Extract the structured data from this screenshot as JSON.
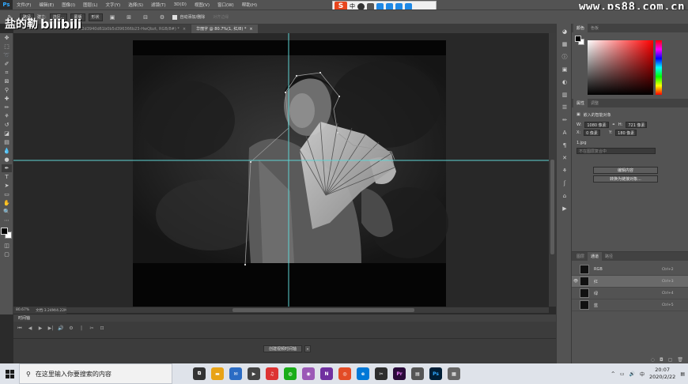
{
  "app": {
    "logo_text": "Ps"
  },
  "menu": [
    "文件(F)",
    "编辑(E)",
    "图像(I)",
    "图层(L)",
    "文字(Y)",
    "选择(S)",
    "滤镜(T)",
    "3D(D)",
    "视图(V)",
    "窗口(W)",
    "帮助(H)"
  ],
  "watermark_site": "www.ps88.com.cn",
  "watermark_logo": {
    "cn": "盐的勒",
    "en": "bilibili"
  },
  "ime": {
    "brand": "S",
    "label": "中"
  },
  "options_bar": {
    "mode": "路径",
    "make_label": "建立:",
    "make_value": "选区...",
    "mask_label": "蒙版",
    "shape_label": "形状",
    "auto_add_label": "自动添加/删除",
    "align_label": "对齐边缘"
  },
  "tabs": [
    {
      "label": "942d3940d61b0b5d396366b23-HwQbzt, RGB/8#) *",
      "active": false
    },
    {
      "label": "华丽字 @ 80.7%(1, 红/8) *",
      "active": true
    }
  ],
  "status": {
    "zoom": "80.67%",
    "doc": "文档:3.24M/4.22M"
  },
  "timeline": {
    "title": "时间轴",
    "create_button": "创建视频时间轴",
    "controls": [
      "⏮",
      "◀",
      "▶",
      "▶|",
      "🔊",
      "⚙",
      "|",
      "✂",
      "⊡"
    ]
  },
  "color_panel": {
    "tabs": [
      "颜色",
      "色板"
    ]
  },
  "properties": {
    "tabs": [
      "属性",
      "调整"
    ],
    "title": "嵌入的智能对象",
    "w_label": "W:",
    "w_value": "1080 像素",
    "h_label": "H:",
    "h_value": "721 像素",
    "x_label": "X:",
    "x_value": "0 像素",
    "y_label": "Y:",
    "y_value": "180 像素",
    "file": "1.jpg",
    "comp_placeholder": "不在图层复合中",
    "edit_button": "编辑内容",
    "convert_button": "转换为链接对象..."
  },
  "channels_panel": {
    "tabs": [
      "图层",
      "通道",
      "路径"
    ],
    "rows": [
      {
        "name": "RGB",
        "shortcut": "Ctrl+2",
        "selected": false
      },
      {
        "name": "红",
        "shortcut": "Ctrl+3",
        "selected": true
      },
      {
        "name": "绿",
        "shortcut": "Ctrl+4",
        "selected": false
      },
      {
        "name": "蓝",
        "shortcut": "Ctrl+5",
        "selected": false
      }
    ]
  },
  "taskbar": {
    "search_placeholder": "在这里输入你要搜索的内容",
    "time": "20:07",
    "date": "2020/2/22",
    "lang": "中"
  },
  "colors": {
    "accent": "#31a8ff",
    "guide": "#5fd3d3",
    "ime_red": "#e8461e"
  }
}
